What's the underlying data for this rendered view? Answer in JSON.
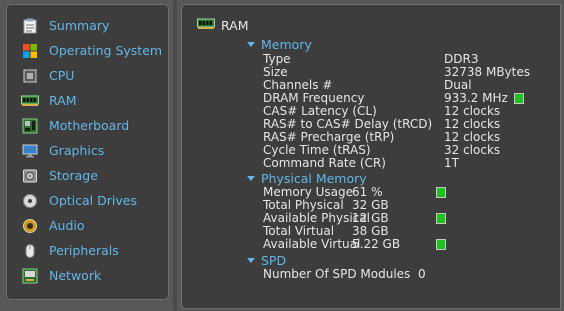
{
  "sidebar": {
    "items": [
      {
        "label": "Summary",
        "icon": "clipboard-icon"
      },
      {
        "label": "Operating System",
        "icon": "windows-logo-icon"
      },
      {
        "label": "CPU",
        "icon": "cpu-chip-icon"
      },
      {
        "label": "RAM",
        "icon": "ram-module-icon"
      },
      {
        "label": "Motherboard",
        "icon": "motherboard-icon"
      },
      {
        "label": "Graphics",
        "icon": "monitor-icon"
      },
      {
        "label": "Storage",
        "icon": "hard-drive-icon"
      },
      {
        "label": "Optical Drives",
        "icon": "optical-disc-icon"
      },
      {
        "label": "Audio",
        "icon": "speaker-icon"
      },
      {
        "label": "Peripherals",
        "icon": "mouse-icon"
      },
      {
        "label": "Network",
        "icon": "network-icon"
      }
    ]
  },
  "main": {
    "title": "RAM",
    "memory": {
      "header": "Memory",
      "rows": [
        {
          "label": "Type",
          "value": "DDR3"
        },
        {
          "label": "Size",
          "value": "32738 MBytes"
        },
        {
          "label": "Channels #",
          "value": "Dual"
        },
        {
          "label": "DRAM Frequency",
          "value": "933.2 MHz"
        },
        {
          "label": "CAS# Latency (CL)",
          "value": "12 clocks"
        },
        {
          "label": "RAS# to CAS# Delay (tRCD)",
          "value": "12 clocks"
        },
        {
          "label": "RAS# Precharge (tRP)",
          "value": "12 clocks"
        },
        {
          "label": "Cycle Time (tRAS)",
          "value": "32 clocks"
        },
        {
          "label": "Command Rate (CR)",
          "value": "1T"
        }
      ]
    },
    "physical": {
      "header": "Physical Memory",
      "rows": [
        {
          "label": "Memory Usage",
          "value": "61 %"
        },
        {
          "label": "Total Physical",
          "value": "32 GB"
        },
        {
          "label": "Available Physical",
          "value": "12 GB"
        },
        {
          "label": "Total Virtual",
          "value": "38 GB"
        },
        {
          "label": "Available Virtual",
          "value": "5.22 GB"
        }
      ]
    },
    "spd": {
      "header": "SPD",
      "rows": [
        {
          "label": "Number Of SPD Modules",
          "value": "0"
        }
      ]
    }
  },
  "colors": {
    "accent": "#62b6e8",
    "indicator": "#1ec21e",
    "panel": "#3d3d3d",
    "background": "#585858"
  }
}
